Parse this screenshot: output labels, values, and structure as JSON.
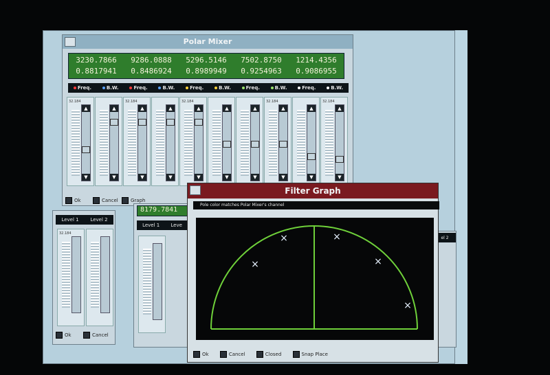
{
  "polar_mixer": {
    "title": "Polar Mixer",
    "readout_row1": [
      "3230.7866",
      "9286.0888",
      "5296.5146",
      "7502.8750",
      "1214.4356"
    ],
    "readout_row2": [
      "0.8817941",
      "0.8486924",
      "0.8989949",
      "0.9254963",
      "0.9086955"
    ],
    "headers": [
      "Freq.",
      "B.W.",
      "Freq.",
      "B.W.",
      "Freq.",
      "B.W.",
      "Freq.",
      "B.W.",
      "Freq.",
      "B.W."
    ],
    "header_dot_colors": [
      "#ff3a3a",
      "#5aa2ff",
      "#ff3a3a",
      "#5aa2ff",
      "#ffd23a",
      "#ffd23a",
      "#9be36b",
      "#9be36b",
      "#ffffff",
      "#ffffff"
    ],
    "channel_values": [
      "32.184",
      "",
      "32.184",
      "",
      "32.184",
      "",
      "",
      "32.184",
      "",
      "32.184"
    ],
    "checkbox_labels": [
      "Ok",
      "Cancel",
      "Graph"
    ]
  },
  "level_panel": {
    "headers": [
      "Level 1",
      "Level 2"
    ],
    "value": "32.184",
    "checkbox_labels": [
      "Ok",
      "Cancel"
    ]
  },
  "level_panel_2": {
    "readout": "8179.7841",
    "headers": [
      "Level 1",
      "Leve"
    ]
  },
  "right_panel": {
    "header": "el 2"
  },
  "filter_graph": {
    "title": "Filter Graph",
    "subtitle": "Pole color matches Polar Mixer's channel",
    "footer_labels": [
      "Ok",
      "Cancel",
      "Closed",
      "Snap Place"
    ]
  },
  "colors": {
    "pole_curve": "#6fd13a",
    "pole_marker": "#e7f2ff",
    "title_red": "#7a1a20",
    "readout_green": "#2f7d2c"
  }
}
